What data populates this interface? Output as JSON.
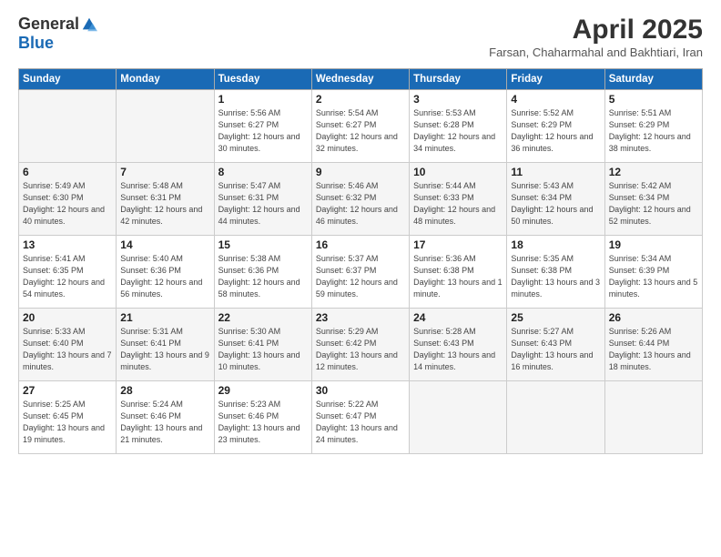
{
  "logo": {
    "general": "General",
    "blue": "Blue"
  },
  "title": "April 2025",
  "subtitle": "Farsan, Chaharmahal and Bakhtiari, Iran",
  "days_of_week": [
    "Sunday",
    "Monday",
    "Tuesday",
    "Wednesday",
    "Thursday",
    "Friday",
    "Saturday"
  ],
  "weeks": [
    [
      {
        "day": "",
        "info": ""
      },
      {
        "day": "",
        "info": ""
      },
      {
        "day": "1",
        "info": "Sunrise: 5:56 AM\nSunset: 6:27 PM\nDaylight: 12 hours and 30 minutes."
      },
      {
        "day": "2",
        "info": "Sunrise: 5:54 AM\nSunset: 6:27 PM\nDaylight: 12 hours and 32 minutes."
      },
      {
        "day": "3",
        "info": "Sunrise: 5:53 AM\nSunset: 6:28 PM\nDaylight: 12 hours and 34 minutes."
      },
      {
        "day": "4",
        "info": "Sunrise: 5:52 AM\nSunset: 6:29 PM\nDaylight: 12 hours and 36 minutes."
      },
      {
        "day": "5",
        "info": "Sunrise: 5:51 AM\nSunset: 6:29 PM\nDaylight: 12 hours and 38 minutes."
      }
    ],
    [
      {
        "day": "6",
        "info": "Sunrise: 5:49 AM\nSunset: 6:30 PM\nDaylight: 12 hours and 40 minutes."
      },
      {
        "day": "7",
        "info": "Sunrise: 5:48 AM\nSunset: 6:31 PM\nDaylight: 12 hours and 42 minutes."
      },
      {
        "day": "8",
        "info": "Sunrise: 5:47 AM\nSunset: 6:31 PM\nDaylight: 12 hours and 44 minutes."
      },
      {
        "day": "9",
        "info": "Sunrise: 5:46 AM\nSunset: 6:32 PM\nDaylight: 12 hours and 46 minutes."
      },
      {
        "day": "10",
        "info": "Sunrise: 5:44 AM\nSunset: 6:33 PM\nDaylight: 12 hours and 48 minutes."
      },
      {
        "day": "11",
        "info": "Sunrise: 5:43 AM\nSunset: 6:34 PM\nDaylight: 12 hours and 50 minutes."
      },
      {
        "day": "12",
        "info": "Sunrise: 5:42 AM\nSunset: 6:34 PM\nDaylight: 12 hours and 52 minutes."
      }
    ],
    [
      {
        "day": "13",
        "info": "Sunrise: 5:41 AM\nSunset: 6:35 PM\nDaylight: 12 hours and 54 minutes."
      },
      {
        "day": "14",
        "info": "Sunrise: 5:40 AM\nSunset: 6:36 PM\nDaylight: 12 hours and 56 minutes."
      },
      {
        "day": "15",
        "info": "Sunrise: 5:38 AM\nSunset: 6:36 PM\nDaylight: 12 hours and 58 minutes."
      },
      {
        "day": "16",
        "info": "Sunrise: 5:37 AM\nSunset: 6:37 PM\nDaylight: 12 hours and 59 minutes."
      },
      {
        "day": "17",
        "info": "Sunrise: 5:36 AM\nSunset: 6:38 PM\nDaylight: 13 hours and 1 minute."
      },
      {
        "day": "18",
        "info": "Sunrise: 5:35 AM\nSunset: 6:38 PM\nDaylight: 13 hours and 3 minutes."
      },
      {
        "day": "19",
        "info": "Sunrise: 5:34 AM\nSunset: 6:39 PM\nDaylight: 13 hours and 5 minutes."
      }
    ],
    [
      {
        "day": "20",
        "info": "Sunrise: 5:33 AM\nSunset: 6:40 PM\nDaylight: 13 hours and 7 minutes."
      },
      {
        "day": "21",
        "info": "Sunrise: 5:31 AM\nSunset: 6:41 PM\nDaylight: 13 hours and 9 minutes."
      },
      {
        "day": "22",
        "info": "Sunrise: 5:30 AM\nSunset: 6:41 PM\nDaylight: 13 hours and 10 minutes."
      },
      {
        "day": "23",
        "info": "Sunrise: 5:29 AM\nSunset: 6:42 PM\nDaylight: 13 hours and 12 minutes."
      },
      {
        "day": "24",
        "info": "Sunrise: 5:28 AM\nSunset: 6:43 PM\nDaylight: 13 hours and 14 minutes."
      },
      {
        "day": "25",
        "info": "Sunrise: 5:27 AM\nSunset: 6:43 PM\nDaylight: 13 hours and 16 minutes."
      },
      {
        "day": "26",
        "info": "Sunrise: 5:26 AM\nSunset: 6:44 PM\nDaylight: 13 hours and 18 minutes."
      }
    ],
    [
      {
        "day": "27",
        "info": "Sunrise: 5:25 AM\nSunset: 6:45 PM\nDaylight: 13 hours and 19 minutes."
      },
      {
        "day": "28",
        "info": "Sunrise: 5:24 AM\nSunset: 6:46 PM\nDaylight: 13 hours and 21 minutes."
      },
      {
        "day": "29",
        "info": "Sunrise: 5:23 AM\nSunset: 6:46 PM\nDaylight: 13 hours and 23 minutes."
      },
      {
        "day": "30",
        "info": "Sunrise: 5:22 AM\nSunset: 6:47 PM\nDaylight: 13 hours and 24 minutes."
      },
      {
        "day": "",
        "info": ""
      },
      {
        "day": "",
        "info": ""
      },
      {
        "day": "",
        "info": ""
      }
    ]
  ]
}
